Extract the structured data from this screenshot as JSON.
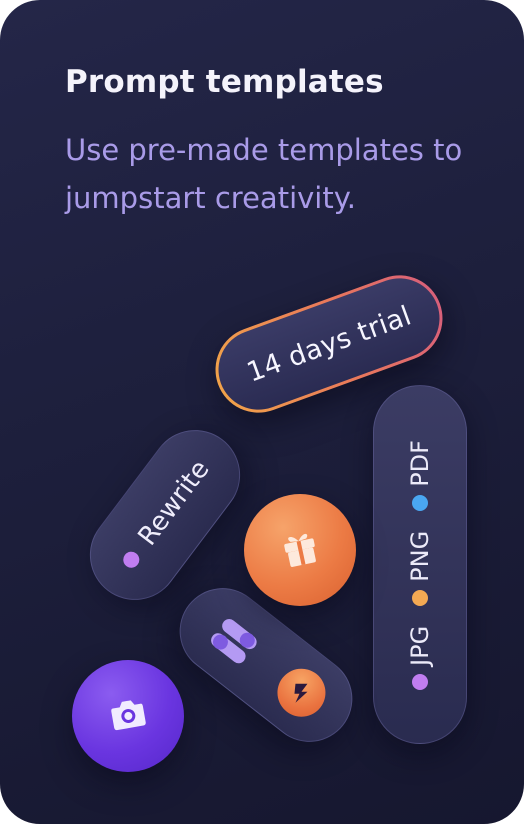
{
  "card": {
    "title": "Prompt templates",
    "subtitle": "Use pre-made templates to jumpstart creativity."
  },
  "badges": {
    "trial": "14 days trial",
    "rewrite": "Rewrite"
  },
  "file_types": [
    {
      "label": "JPG",
      "dot_color": "#c07df0"
    },
    {
      "label": "PNG",
      "dot_color": "#f4a953"
    },
    {
      "label": "PDF",
      "dot_color": "#4aa7f2"
    }
  ],
  "icons": {
    "gift": "gift-icon",
    "camera": "camera-icon",
    "toggle": "toggle-icon",
    "zap": "zap-icon"
  },
  "colors": {
    "background": "#1d1f3c",
    "title": "#f4f3fb",
    "subtitle": "#a99be8",
    "trial_border_start": "#f1a24a",
    "trial_border_end": "#d8607a",
    "gift_circle": "#ec7b45",
    "camera_circle": "#6a35e0",
    "rewrite_dot": "#c07df0"
  }
}
